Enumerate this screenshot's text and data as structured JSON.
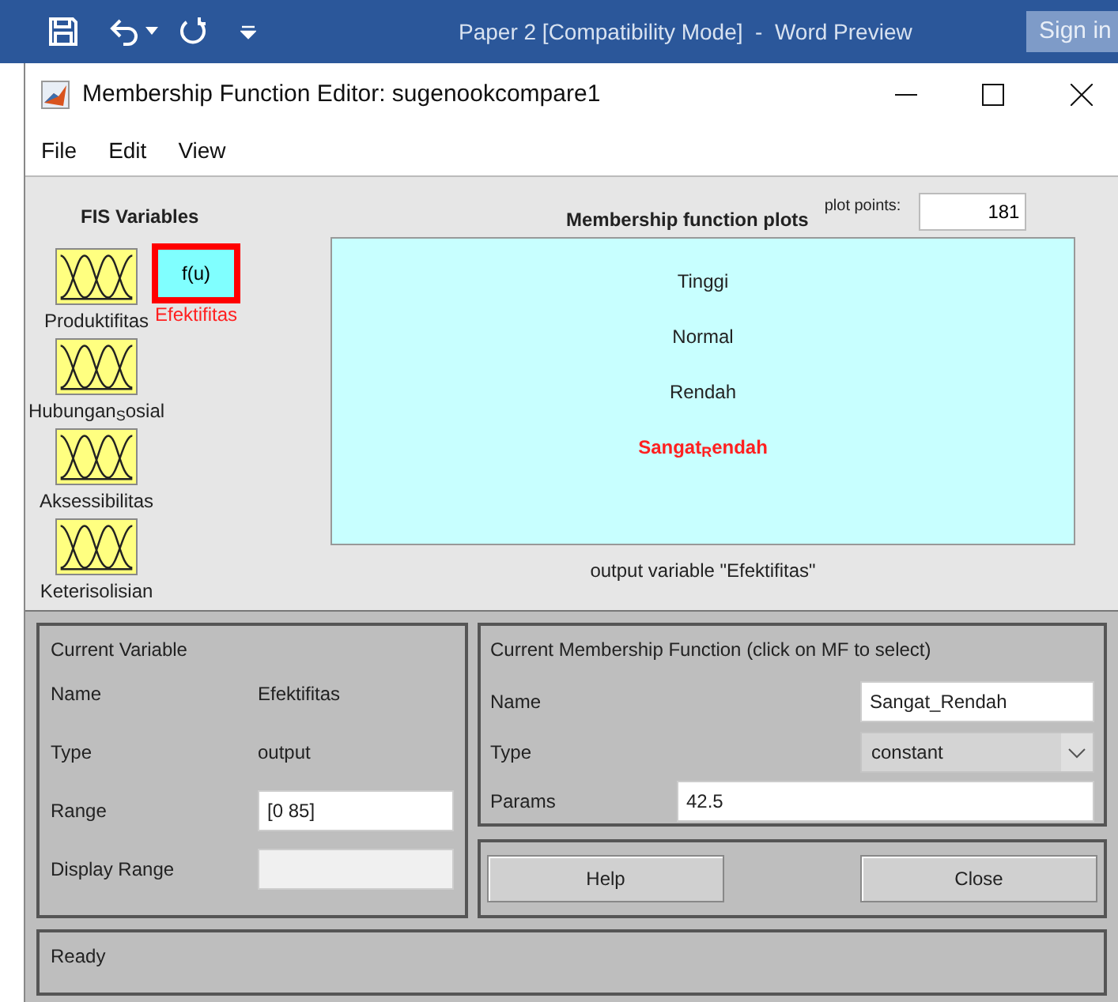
{
  "host_bar": {
    "title": "Paper 2 [Compatibility Mode]  -  Word Preview",
    "sign_in": "Sign in"
  },
  "window": {
    "title": "Membership Function Editor: sugenookcompare1"
  },
  "menu": [
    "File",
    "Edit",
    "View"
  ],
  "fis_variables": {
    "title": "FIS Variables",
    "inputs": [
      {
        "label": "Produktifitas",
        "selected": false
      },
      {
        "label": "Hubungan$_{S}$osial",
        "selected": false
      },
      {
        "label": "Aksessibilitas",
        "selected": false
      },
      {
        "label": "Keterisolisian",
        "selected": false
      }
    ],
    "outputs": [
      {
        "label": "Efektifitas",
        "icon_text": "f(u)",
        "selected": true
      }
    ]
  },
  "plot": {
    "title": "Membership function plots",
    "plot_points_label": "plot points:",
    "plot_points": "181",
    "mfs": [
      {
        "label": "Tinggi",
        "selected": false
      },
      {
        "label": "Normal",
        "selected": false
      },
      {
        "label": "Rendah",
        "selected": false
      },
      {
        "label": "Sangat$_{R}$endah",
        "selected": true
      }
    ],
    "caption": "output variable \"Efektifitas\""
  },
  "current_variable": {
    "title": "Current Variable",
    "rows": [
      {
        "kind": "text",
        "label": "Name",
        "value": "Efektifitas"
      },
      {
        "kind": "text",
        "label": "Type",
        "value": "output"
      },
      {
        "kind": "field",
        "label": "Range",
        "value": "[0 85]"
      },
      {
        "kind": "field",
        "label": "Display Range",
        "disabled": true
      }
    ]
  },
  "current_mf": {
    "title": "Current Membership Function (click on MF to select)",
    "name_label": "Name",
    "name": "Sangat_Rendah",
    "type_label": "Type",
    "type": "constant",
    "params_label": "Params",
    "params": "42.5"
  },
  "buttons": [
    "Help",
    "Close"
  ],
  "status": "Ready"
}
